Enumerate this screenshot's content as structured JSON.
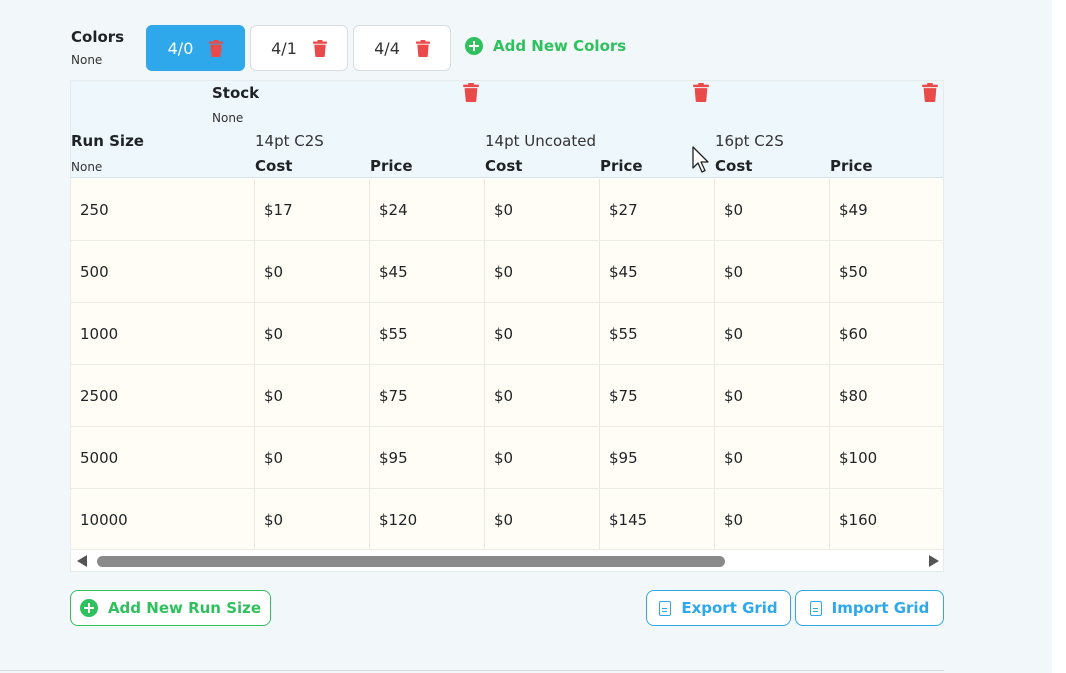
{
  "colors": {
    "label": "Colors",
    "value": "None",
    "tabs": [
      {
        "label": "4/0",
        "active": true
      },
      {
        "label": "4/1",
        "active": false
      },
      {
        "label": "4/4",
        "active": false
      }
    ],
    "add_label": "Add New Colors"
  },
  "grid": {
    "stock_label": "Stock",
    "stock_value": "None",
    "run_size_label": "Run Size",
    "run_size_value": "None",
    "papers": [
      "14pt C2S",
      "14pt Uncoated",
      "16pt C2S"
    ],
    "cost_label": "Cost",
    "price_label": "Price",
    "rows": [
      {
        "run": "250",
        "cells": [
          "$17",
          "$24",
          "$0",
          "$27",
          "$0",
          "$49"
        ]
      },
      {
        "run": "500",
        "cells": [
          "$0",
          "$45",
          "$0",
          "$45",
          "$0",
          "$50"
        ]
      },
      {
        "run": "1000",
        "cells": [
          "$0",
          "$55",
          "$0",
          "$55",
          "$0",
          "$60"
        ]
      },
      {
        "run": "2500",
        "cells": [
          "$0",
          "$75",
          "$0",
          "$75",
          "$0",
          "$80"
        ]
      },
      {
        "run": "5000",
        "cells": [
          "$0",
          "$95",
          "$0",
          "$95",
          "$0",
          "$100"
        ]
      },
      {
        "run": "10000",
        "cells": [
          "$0",
          "$120",
          "$0",
          "$145",
          "$0",
          "$160"
        ]
      }
    ]
  },
  "actions": {
    "add_run_size": "Add New Run Size",
    "export": "Export Grid",
    "import": "Import Grid"
  },
  "theme": {
    "accent_blue": "#2ea8ea",
    "accent_green": "#2fc15e",
    "danger_red": "#e94b4b"
  }
}
